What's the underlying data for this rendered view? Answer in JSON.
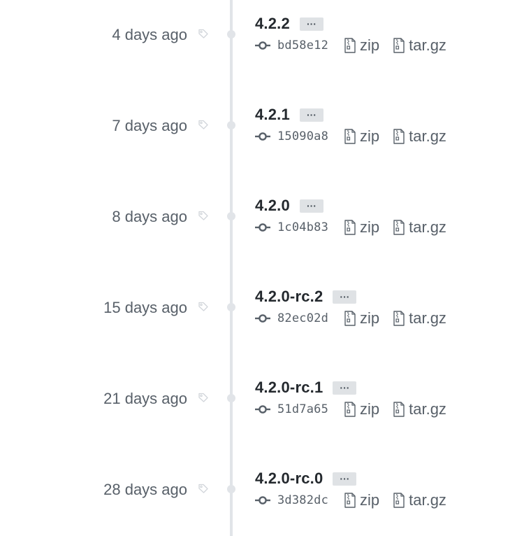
{
  "releases": [
    {
      "date": "4 days ago",
      "version": "4.2.2",
      "sha": "bd58e12",
      "more_label": "···",
      "zip_label": "zip",
      "targz_label": "tar.gz"
    },
    {
      "date": "7 days ago",
      "version": "4.2.1",
      "sha": "15090a8",
      "more_label": "···",
      "zip_label": "zip",
      "targz_label": "tar.gz"
    },
    {
      "date": "8 days ago",
      "version": "4.2.0",
      "sha": "1c04b83",
      "more_label": "···",
      "zip_label": "zip",
      "targz_label": "tar.gz"
    },
    {
      "date": "15 days ago",
      "version": "4.2.0-rc.2",
      "sha": "82ec02d",
      "more_label": "···",
      "zip_label": "zip",
      "targz_label": "tar.gz"
    },
    {
      "date": "21 days ago",
      "version": "4.2.0-rc.1",
      "sha": "51d7a65",
      "more_label": "···",
      "zip_label": "zip",
      "targz_label": "tar.gz"
    },
    {
      "date": "28 days ago",
      "version": "4.2.0-rc.0",
      "sha": "3d382dc",
      "more_label": "···",
      "zip_label": "zip",
      "targz_label": "tar.gz"
    }
  ],
  "icons": {
    "tag": "tag-icon",
    "commit": "git-commit-icon",
    "archive": "file-zip-icon"
  },
  "colors": {
    "timeline": "#e1e4e8",
    "muted_text": "#586069",
    "title_text": "#24292e",
    "button_bg": "#dfe2e5"
  }
}
